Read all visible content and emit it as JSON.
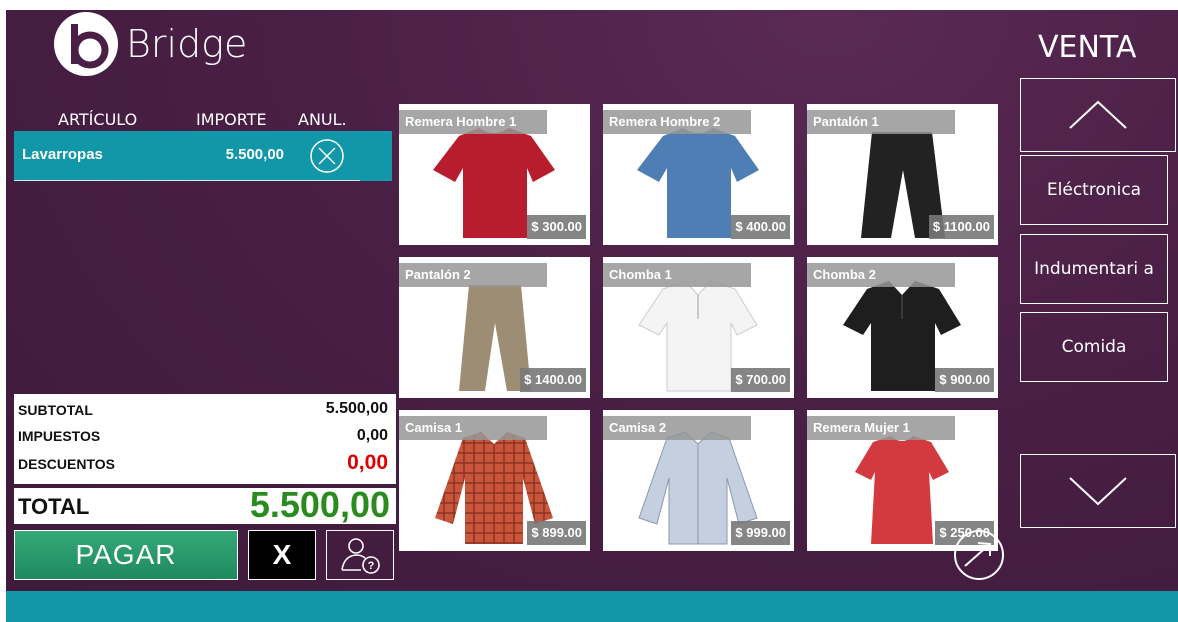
{
  "app": {
    "brand": "Bridge",
    "screen_title": "VENTA"
  },
  "ticket": {
    "headers": {
      "article": "ARTÍCULO",
      "amount": "IMPORTE",
      "cancel": "ANUL."
    },
    "items": [
      {
        "name": "Lavarropas",
        "amount": "5.500,00"
      }
    ]
  },
  "summary": {
    "subtotal_label": "SUBTOTAL",
    "subtotal": "5.500,00",
    "taxes_label": "IMPUESTOS",
    "taxes": "0,00",
    "discounts_label": "DESCUENTOS",
    "discounts": "0,00",
    "total_label": "TOTAL",
    "total": "5.500,00"
  },
  "actions": {
    "pay": "PAGAR",
    "cancel": "X"
  },
  "products": [
    {
      "name": "Remera Hombre 1",
      "price": "$ 300.00",
      "icon": "tshirt-red"
    },
    {
      "name": "Remera Hombre 2",
      "price": "$ 400.00",
      "icon": "tshirt-blue"
    },
    {
      "name": "Pantalón 1",
      "price": "$ 1100.00",
      "icon": "pants-black"
    },
    {
      "name": "Pantalón 2",
      "price": "$ 1400.00",
      "icon": "pants-khaki"
    },
    {
      "name": "Chomba 1",
      "price": "$ 700.00",
      "icon": "polo-white"
    },
    {
      "name": "Chomba 2",
      "price": "$ 900.00",
      "icon": "polo-black"
    },
    {
      "name": "Camisa 1",
      "price": "$ 899.00",
      "icon": "shirt-plaid"
    },
    {
      "name": "Camisa 2",
      "price": "$ 999.00",
      "icon": "shirt-lightblue"
    },
    {
      "name": "Remera Mujer 1",
      "price": "$ 250.00",
      "icon": "tshirt-women-red"
    }
  ],
  "categories": [
    "Eléctronica",
    "Indumentari a",
    "Comida"
  ],
  "colors": {
    "accent": "#1197a8",
    "background": "#4a1f45",
    "pay_button": "#28996a",
    "total_green": "#2a8c1f",
    "discount_red": "#e00000"
  }
}
